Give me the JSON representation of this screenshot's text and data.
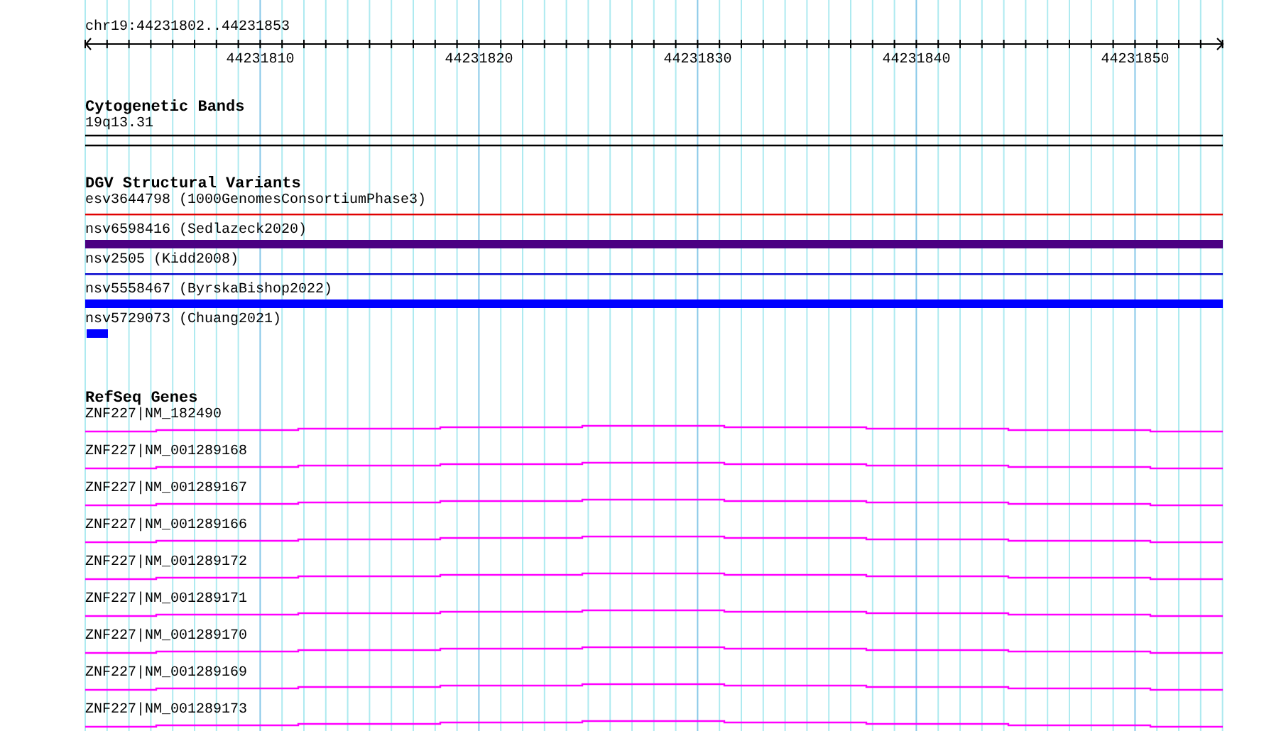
{
  "ruler": {
    "position": "chr19:44231802..44231853",
    "tick_labels": [
      "44231810",
      "44231820",
      "44231830",
      "44231840",
      "44231850"
    ]
  },
  "tracks": [
    {
      "kind": "cytoband",
      "title": "Cytogenetic Bands",
      "items": [
        {
          "label": "19q13.31"
        }
      ]
    },
    {
      "kind": "variants",
      "title": "DGV Structural Variants",
      "items": [
        {
          "label": "esv3644798 (1000GenomesConsortiumPhase3)",
          "kind": "line",
          "color": "#e00000"
        },
        {
          "label": "nsv6598416 (Sedlazeck2020)",
          "kind": "bar",
          "color": "#4b0082"
        },
        {
          "label": "nsv2505 (Kidd2008)",
          "kind": "line",
          "color": "#0000cc"
        },
        {
          "label": "nsv5558467 (ByrskaBishop2022)",
          "kind": "bar",
          "color": "#0000ff"
        },
        {
          "label": "nsv5729073 (Chuang2021)",
          "kind": "stub",
          "color": "#0000ff"
        }
      ]
    },
    {
      "kind": "genes",
      "title": "RefSeq Genes",
      "items": [
        {
          "label": "ZNF227|NM_182490"
        },
        {
          "label": "ZNF227|NM_001289168"
        },
        {
          "label": "ZNF227|NM_001289167"
        },
        {
          "label": "ZNF227|NM_001289166"
        },
        {
          "label": "ZNF227|NM_001289172"
        },
        {
          "label": "ZNF227|NM_001289171"
        },
        {
          "label": "ZNF227|NM_001289170"
        },
        {
          "label": "ZNF227|NM_001289169"
        },
        {
          "label": "ZNF227|NM_001289173"
        }
      ]
    }
  ]
}
